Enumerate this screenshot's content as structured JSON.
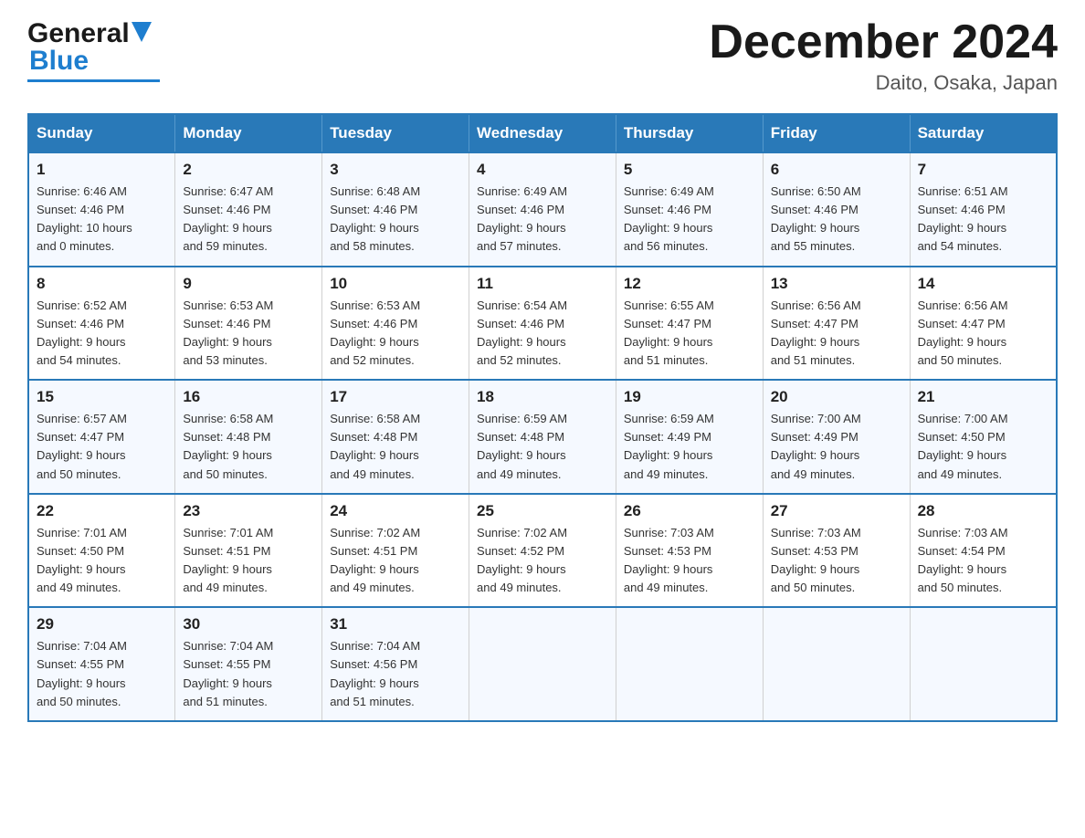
{
  "logo": {
    "general": "General",
    "blue": "Blue"
  },
  "title": "December 2024",
  "location": "Daito, Osaka, Japan",
  "days_of_week": [
    "Sunday",
    "Monday",
    "Tuesday",
    "Wednesday",
    "Thursday",
    "Friday",
    "Saturday"
  ],
  "weeks": [
    [
      {
        "day": "1",
        "sunrise": "6:46 AM",
        "sunset": "4:46 PM",
        "daylight": "10 hours and 0 minutes."
      },
      {
        "day": "2",
        "sunrise": "6:47 AM",
        "sunset": "4:46 PM",
        "daylight": "9 hours and 59 minutes."
      },
      {
        "day": "3",
        "sunrise": "6:48 AM",
        "sunset": "4:46 PM",
        "daylight": "9 hours and 58 minutes."
      },
      {
        "day": "4",
        "sunrise": "6:49 AM",
        "sunset": "4:46 PM",
        "daylight": "9 hours and 57 minutes."
      },
      {
        "day": "5",
        "sunrise": "6:49 AM",
        "sunset": "4:46 PM",
        "daylight": "9 hours and 56 minutes."
      },
      {
        "day": "6",
        "sunrise": "6:50 AM",
        "sunset": "4:46 PM",
        "daylight": "9 hours and 55 minutes."
      },
      {
        "day": "7",
        "sunrise": "6:51 AM",
        "sunset": "4:46 PM",
        "daylight": "9 hours and 54 minutes."
      }
    ],
    [
      {
        "day": "8",
        "sunrise": "6:52 AM",
        "sunset": "4:46 PM",
        "daylight": "9 hours and 54 minutes."
      },
      {
        "day": "9",
        "sunrise": "6:53 AM",
        "sunset": "4:46 PM",
        "daylight": "9 hours and 53 minutes."
      },
      {
        "day": "10",
        "sunrise": "6:53 AM",
        "sunset": "4:46 PM",
        "daylight": "9 hours and 52 minutes."
      },
      {
        "day": "11",
        "sunrise": "6:54 AM",
        "sunset": "4:46 PM",
        "daylight": "9 hours and 52 minutes."
      },
      {
        "day": "12",
        "sunrise": "6:55 AM",
        "sunset": "4:47 PM",
        "daylight": "9 hours and 51 minutes."
      },
      {
        "day": "13",
        "sunrise": "6:56 AM",
        "sunset": "4:47 PM",
        "daylight": "9 hours and 51 minutes."
      },
      {
        "day": "14",
        "sunrise": "6:56 AM",
        "sunset": "4:47 PM",
        "daylight": "9 hours and 50 minutes."
      }
    ],
    [
      {
        "day": "15",
        "sunrise": "6:57 AM",
        "sunset": "4:47 PM",
        "daylight": "9 hours and 50 minutes."
      },
      {
        "day": "16",
        "sunrise": "6:58 AM",
        "sunset": "4:48 PM",
        "daylight": "9 hours and 50 minutes."
      },
      {
        "day": "17",
        "sunrise": "6:58 AM",
        "sunset": "4:48 PM",
        "daylight": "9 hours and 49 minutes."
      },
      {
        "day": "18",
        "sunrise": "6:59 AM",
        "sunset": "4:48 PM",
        "daylight": "9 hours and 49 minutes."
      },
      {
        "day": "19",
        "sunrise": "6:59 AM",
        "sunset": "4:49 PM",
        "daylight": "9 hours and 49 minutes."
      },
      {
        "day": "20",
        "sunrise": "7:00 AM",
        "sunset": "4:49 PM",
        "daylight": "9 hours and 49 minutes."
      },
      {
        "day": "21",
        "sunrise": "7:00 AM",
        "sunset": "4:50 PM",
        "daylight": "9 hours and 49 minutes."
      }
    ],
    [
      {
        "day": "22",
        "sunrise": "7:01 AM",
        "sunset": "4:50 PM",
        "daylight": "9 hours and 49 minutes."
      },
      {
        "day": "23",
        "sunrise": "7:01 AM",
        "sunset": "4:51 PM",
        "daylight": "9 hours and 49 minutes."
      },
      {
        "day": "24",
        "sunrise": "7:02 AM",
        "sunset": "4:51 PM",
        "daylight": "9 hours and 49 minutes."
      },
      {
        "day": "25",
        "sunrise": "7:02 AM",
        "sunset": "4:52 PM",
        "daylight": "9 hours and 49 minutes."
      },
      {
        "day": "26",
        "sunrise": "7:03 AM",
        "sunset": "4:53 PM",
        "daylight": "9 hours and 49 minutes."
      },
      {
        "day": "27",
        "sunrise": "7:03 AM",
        "sunset": "4:53 PM",
        "daylight": "9 hours and 50 minutes."
      },
      {
        "day": "28",
        "sunrise": "7:03 AM",
        "sunset": "4:54 PM",
        "daylight": "9 hours and 50 minutes."
      }
    ],
    [
      {
        "day": "29",
        "sunrise": "7:04 AM",
        "sunset": "4:55 PM",
        "daylight": "9 hours and 50 minutes."
      },
      {
        "day": "30",
        "sunrise": "7:04 AM",
        "sunset": "4:55 PM",
        "daylight": "9 hours and 51 minutes."
      },
      {
        "day": "31",
        "sunrise": "7:04 AM",
        "sunset": "4:56 PM",
        "daylight": "9 hours and 51 minutes."
      },
      null,
      null,
      null,
      null
    ]
  ],
  "labels": {
    "sunrise": "Sunrise:",
    "sunset": "Sunset:",
    "daylight": "Daylight:"
  }
}
